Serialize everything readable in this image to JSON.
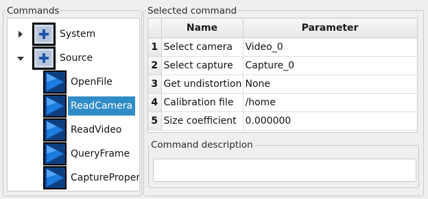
{
  "commands_panel": {
    "title": "Commands",
    "tree": [
      {
        "label": "System",
        "expanded": false,
        "icon": "plus-square-icon"
      },
      {
        "label": "Source",
        "expanded": true,
        "icon": "plus-square-icon",
        "children": [
          {
            "label": "OpenFile",
            "icon": "play-arrow-icon",
            "selected": false
          },
          {
            "label": "ReadCamera",
            "icon": "play-arrow-icon",
            "selected": true
          },
          {
            "label": "ReadVideo",
            "icon": "play-arrow-icon",
            "selected": false
          },
          {
            "label": "QueryFrame",
            "icon": "play-arrow-icon",
            "selected": false
          },
          {
            "label": "CaptureProperty",
            "icon": "play-arrow-icon",
            "selected": false
          }
        ]
      }
    ]
  },
  "selected_command_panel": {
    "title": "Selected command",
    "table": {
      "columns": [
        "Name",
        "Parameter"
      ],
      "rows": [
        {
          "index": "1",
          "name": "Select camera",
          "value": "Video_0"
        },
        {
          "index": "2",
          "name": "Select capture",
          "value": "Capture_0"
        },
        {
          "index": "3",
          "name": "Get undistortion c",
          "value": "None"
        },
        {
          "index": "4",
          "name": "Calibration file",
          "value": "/home"
        },
        {
          "index": "5",
          "name": "Size coefficient",
          "value": "0.000000"
        }
      ]
    },
    "description": {
      "title": "Command description",
      "value": ""
    }
  },
  "colors": {
    "selection": "#308cc6",
    "icon_blue": "#1565c0",
    "window_bg": "#efefef"
  }
}
